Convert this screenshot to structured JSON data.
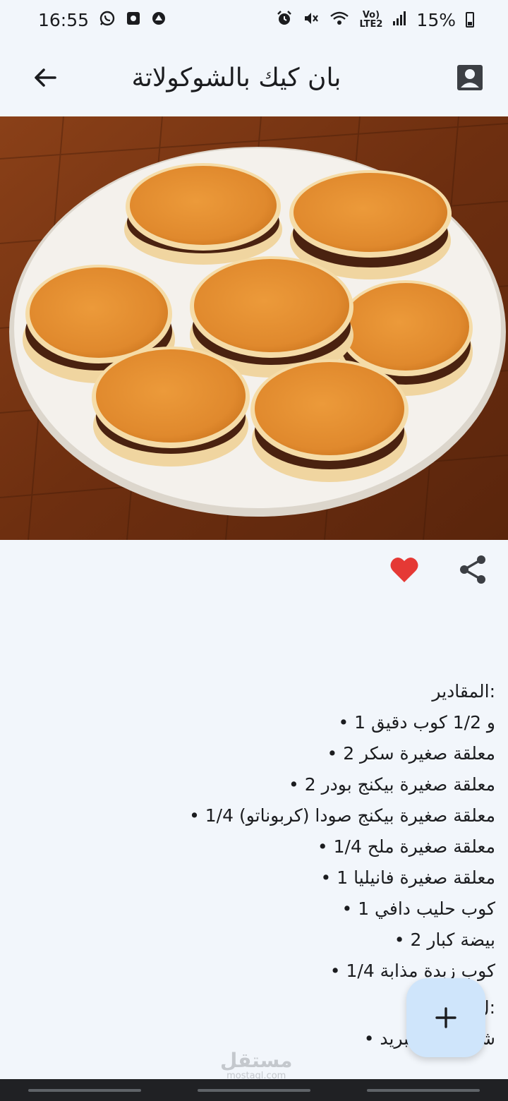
{
  "status_bar": {
    "time": "16:55",
    "network_top": "Vo)",
    "network_bottom": "LTE2",
    "battery": "15%",
    "left_icons": [
      "whatsapp-icon",
      "media-icon",
      "vpn-icon"
    ],
    "right_icons": [
      "alarm-icon",
      "mute-icon",
      "wifi-icon",
      "signal-icon"
    ]
  },
  "app_bar": {
    "title": "بان كيك بالشوكولاتة",
    "back_icon": "arrow-back-icon",
    "profile_icon": "account-box-icon"
  },
  "hero": {
    "alt": "chocolate pancakes on plate",
    "table_color": "#7a3614",
    "plate_color": "#f4f1ec",
    "pancake_color": "#e89a3c",
    "filling_color": "#4a2210"
  },
  "actions": {
    "favorite_icon": "heart-icon",
    "favorite_color": "#e53935",
    "share_icon": "share-icon"
  },
  "recipe": {
    "ingredients_heading": ":المقادير",
    "ingredients": [
      "و 1/2 كوب دقيق 1 •",
      "معلقة صغيرة سكر 2 •",
      "معلقة صغيرة بيكنج بودر 2 •",
      "معلقة صغيرة بيكنج صودا (كربوناتو) 1/4 •",
      "معلقة صغيرة ملح 1/4 •",
      "معلقة صغيرة فانيليا 1 •",
      "كوب حليب دافي 1 •",
      "بيضة كبار 2 •",
      "كوب زبدة مذابة 1/4 •"
    ],
    "partial_heading": ":ل",
    "partial_item": "شوكولاته سبريد •"
  },
  "fab": {
    "icon": "plus-icon",
    "color": "#cfe5fb"
  },
  "watermark": {
    "arabic": "مستقل",
    "latin": "mostaql.com"
  }
}
